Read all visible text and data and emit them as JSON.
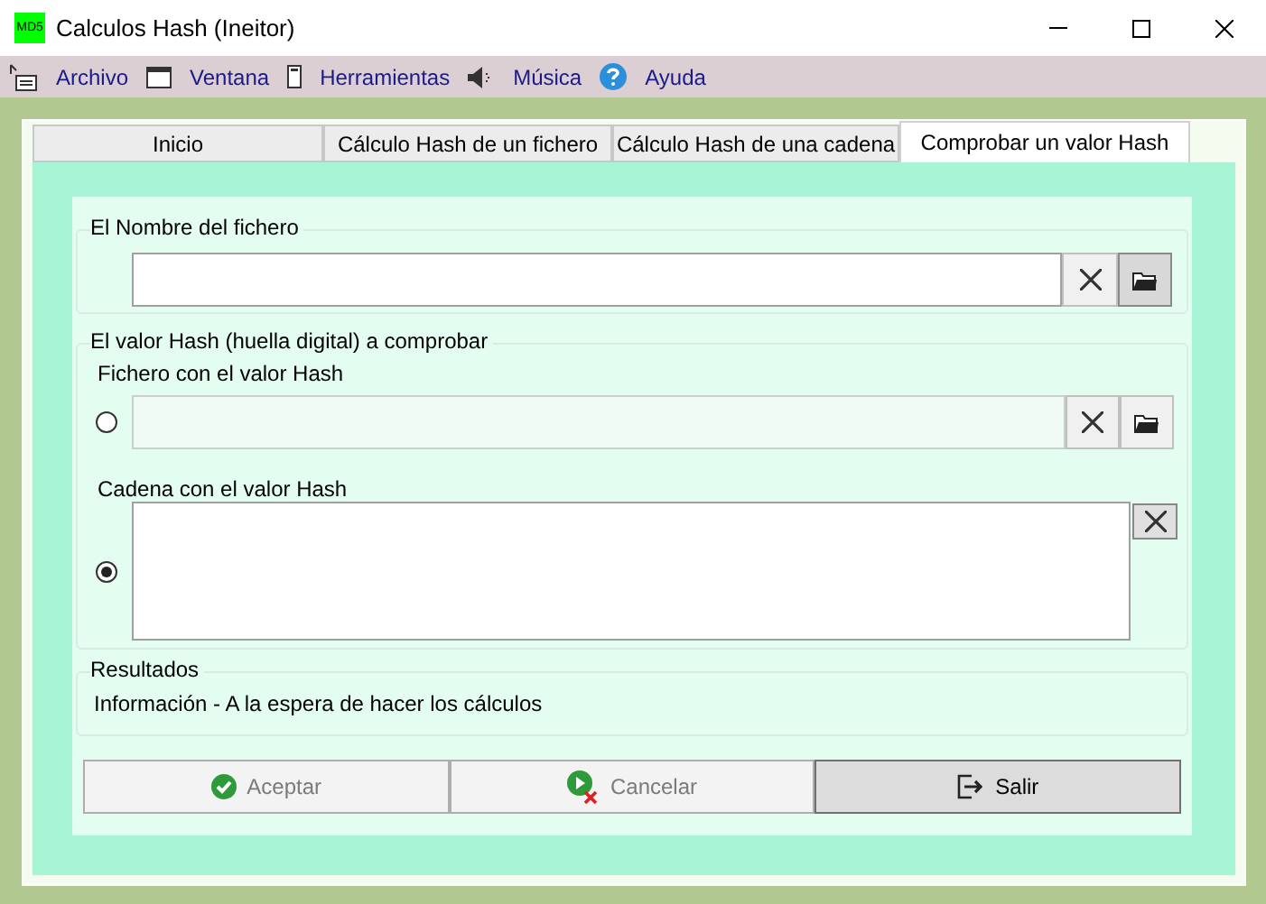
{
  "window": {
    "title": "Calculos Hash (Ineitor)",
    "icon_text": "MD5"
  },
  "menu": [
    {
      "label": "Archivo"
    },
    {
      "label": "Ventana"
    },
    {
      "label": "Herramientas"
    },
    {
      "label": "Música"
    },
    {
      "label": "Ayuda"
    }
  ],
  "tabs": [
    {
      "label": "Inicio",
      "selected": false
    },
    {
      "label": "Cálculo Hash de un fichero",
      "selected": false
    },
    {
      "label": "Cálculo Hash de una cadena",
      "selected": false
    },
    {
      "label": "Comprobar un valor Hash",
      "selected": true
    }
  ],
  "file_group": {
    "title": "El Nombre del fichero",
    "browse_pressed": true
  },
  "hash_group": {
    "title": "El valor Hash (huella digital) a comprobar",
    "sources": [
      {
        "kind": "file",
        "label": "Fichero con el valor Hash",
        "selected": false
      },
      {
        "kind": "text",
        "label": "Cadena con el valor Hash",
        "selected": true
      }
    ]
  },
  "results": {
    "title": "Resultados",
    "text": "Información - A la espera de hacer los cálculos"
  },
  "buttons": [
    {
      "label": "Aceptar",
      "disabled": true
    },
    {
      "label": "Cancelar",
      "disabled": true
    },
    {
      "label": "Salir",
      "disabled": false
    }
  ]
}
